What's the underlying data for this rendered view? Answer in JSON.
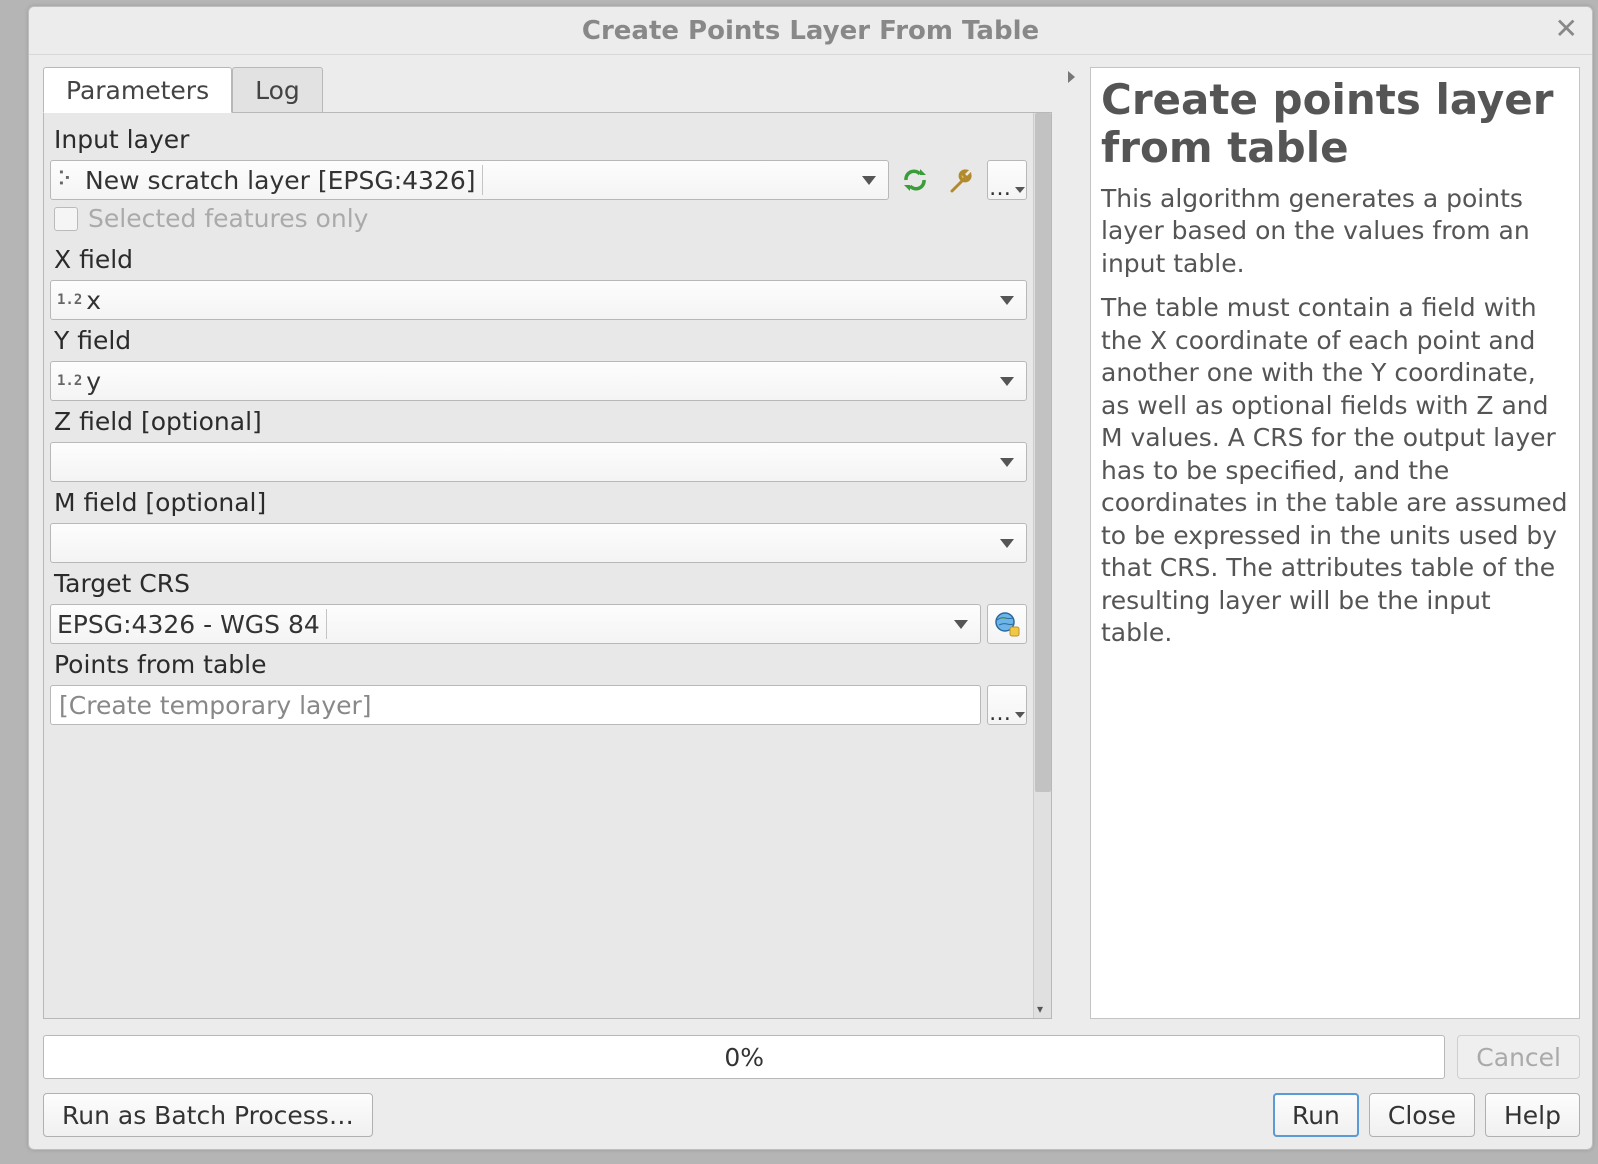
{
  "window": {
    "title": "Create Points Layer From Table"
  },
  "tabs": {
    "parameters": "Parameters",
    "log": "Log"
  },
  "params": {
    "input_layer_label": "Input layer",
    "input_layer_value": "New scratch layer [EPSG:4326]",
    "selected_only_label": "Selected features only",
    "x_field_label": "X field",
    "x_field_value": "x",
    "y_field_label": "Y field",
    "y_field_value": "y",
    "z_field_label": "Z field [optional]",
    "z_field_value": "",
    "m_field_label": "M field [optional]",
    "m_field_value": "",
    "target_crs_label": "Target CRS",
    "target_crs_value": "EPSG:4326 - WGS 84",
    "output_label": "Points from table",
    "output_placeholder": "[Create temporary layer]"
  },
  "help": {
    "title": "Create points layer from table",
    "p1": "This algorithm generates a points layer based on the values from an input table.",
    "p2": "The table must contain a field with the X coordinate of each point and another one with the Y coordinate, as well as optional fields with Z and M values. A CRS for the output layer has to be specified, and the coordinates in the table are assumed to be expressed in the units used by that CRS. The attributes table of the resulting layer will be the input table."
  },
  "progress": {
    "text": "0%"
  },
  "buttons": {
    "cancel": "Cancel",
    "batch": "Run as Batch Process…",
    "run": "Run",
    "close": "Close",
    "helpbtn": "Help"
  }
}
